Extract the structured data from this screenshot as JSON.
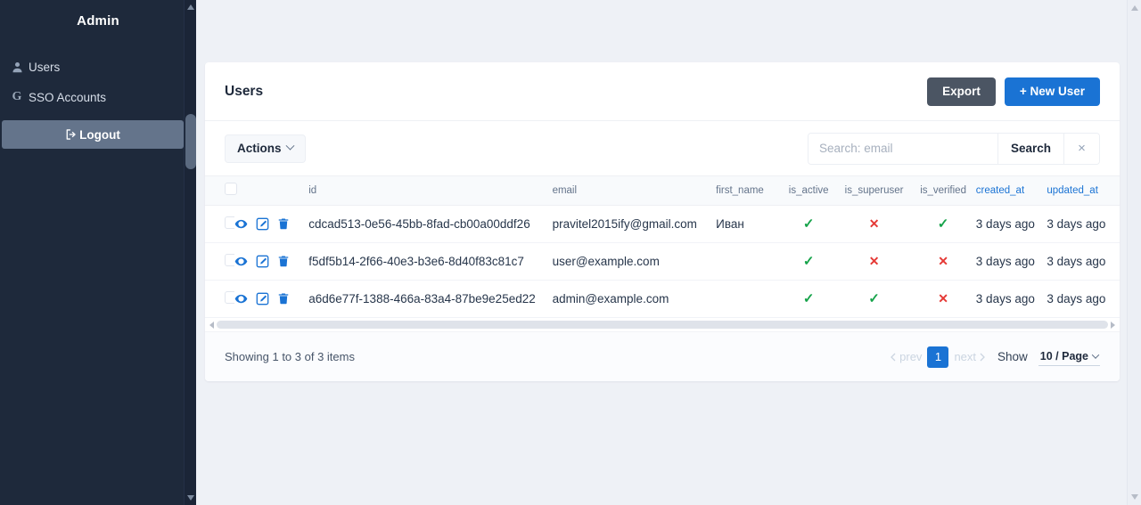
{
  "sidebar": {
    "brand": "Admin",
    "items": [
      {
        "label": "Users",
        "icon": "user-icon"
      },
      {
        "label": "SSO Accounts",
        "icon": "google-g-icon"
      }
    ],
    "logout": {
      "label": "Logout",
      "icon": "sign-out-icon"
    }
  },
  "card": {
    "title": "Users",
    "export_label": "Export",
    "new_user_label": "+ New User"
  },
  "toolbar": {
    "actions_label": "Actions",
    "search_placeholder": "Search: email",
    "search_value": "",
    "search_button_label": "Search",
    "clear_label": "×"
  },
  "table": {
    "columns": [
      {
        "key": "id",
        "label": "id",
        "sortable": false
      },
      {
        "key": "email",
        "label": "email",
        "sortable": false
      },
      {
        "key": "first_name",
        "label": "first_name",
        "sortable": false
      },
      {
        "key": "is_active",
        "label": "is_active",
        "sortable": false
      },
      {
        "key": "is_superuser",
        "label": "is_superuser",
        "sortable": false
      },
      {
        "key": "is_verified",
        "label": "is_verified",
        "sortable": false
      },
      {
        "key": "created_at",
        "label": "created_at",
        "sortable": true
      },
      {
        "key": "updated_at",
        "label": "updated_at",
        "sortable": true
      }
    ],
    "row_actions": [
      "view-icon",
      "edit-icon",
      "delete-icon"
    ],
    "rows": [
      {
        "id": "cdcad513-0e56-45bb-8fad-cb00a00ddf26",
        "email": "pravitel2015ify@gmail.com",
        "first_name": "Иван",
        "is_active": true,
        "is_superuser": false,
        "is_verified": true,
        "created_at": "3 days ago",
        "updated_at": "3 days ago"
      },
      {
        "id": "f5df5b14-2f66-40e3-b3e6-8d40f83c81c7",
        "email": "user@example.com",
        "first_name": "",
        "is_active": true,
        "is_superuser": false,
        "is_verified": false,
        "created_at": "3 days ago",
        "updated_at": "3 days ago"
      },
      {
        "id": "a6d6e77f-1388-466a-83a4-87be9e25ed22",
        "email": "admin@example.com",
        "first_name": "",
        "is_active": true,
        "is_superuser": true,
        "is_verified": false,
        "created_at": "3 days ago",
        "updated_at": "3 days ago"
      }
    ],
    "mark_true": "✓",
    "mark_false": "✕"
  },
  "footer": {
    "showing": "Showing 1 to 3 of 3 items",
    "prev_label": "prev",
    "next_label": "next",
    "current_page": "1",
    "show_label": "Show",
    "per_page": "10 / Page"
  },
  "colors": {
    "sidebar_bg": "#1e293b",
    "accent_blue": "#1a73d4",
    "export_gray": "#4b5563",
    "success_green": "#16a34a",
    "danger_red": "#e53935",
    "page_bg": "#eef1f6"
  }
}
